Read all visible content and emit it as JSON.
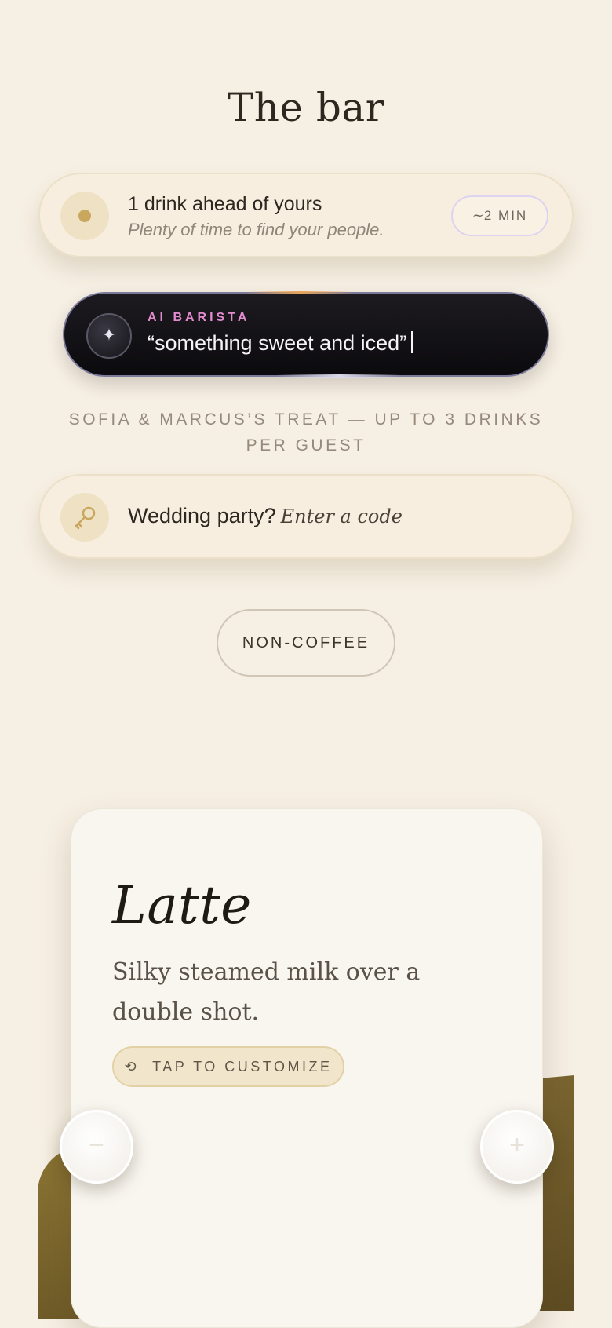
{
  "page": {
    "title": "The bar"
  },
  "queue": {
    "status": "1 drink ahead of yours",
    "subtitle": "Plenty of time to find your people.",
    "eta_tilde": "~",
    "eta_value": "2 MIN"
  },
  "ai_barista": {
    "label": "AI BARISTA",
    "input_value": "“something sweet and iced”",
    "icon": "sparkle-icon"
  },
  "treat_banner": "SOFIA & MARCUS’S TREAT — UP TO 3 DRINKS PER GUEST",
  "wedding_code": {
    "prompt": "Wedding party?",
    "link": "Enter a code",
    "icon": "key-icon"
  },
  "category_filter": {
    "label": "NON-COFFEE"
  },
  "drink_card": {
    "name": "Latte",
    "description": "Silky steamed milk over a double shot.",
    "customize_label": "TAP TO CUSTOMIZE",
    "customize_icon": "⟲"
  },
  "carousel": {
    "prev_label": "−",
    "next_label": "+"
  },
  "colors": {
    "background": "#f6efe3",
    "accent_gold": "#c9a75e",
    "ai_pink": "#e48bd0",
    "ai_bg": "#0b0a0d",
    "liquid": "#7a6530"
  }
}
